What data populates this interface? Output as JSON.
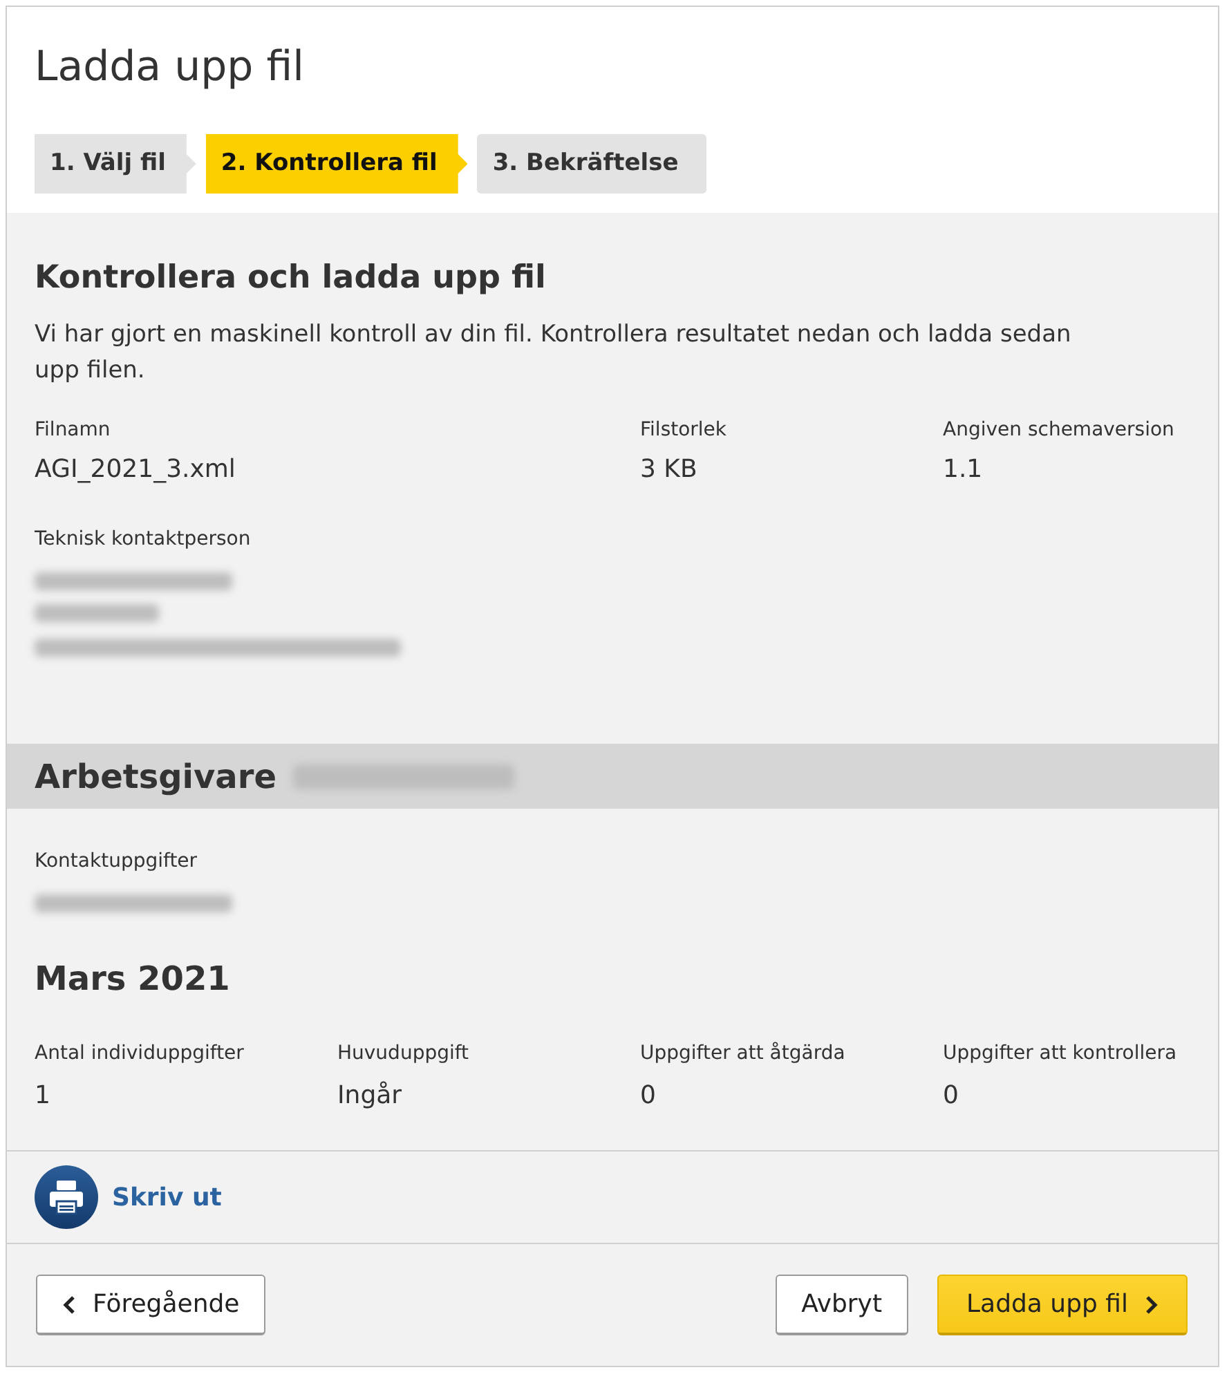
{
  "header": {
    "title": "Ladda upp fil"
  },
  "steps": [
    {
      "label": "1. Välj fil",
      "selected": false
    },
    {
      "label": "2. Kontrollera fil",
      "selected": true
    },
    {
      "label": "3. Bekräftelse",
      "selected": false
    }
  ],
  "check": {
    "heading": "Kontrollera och ladda upp fil",
    "text": "Vi har gjort en maskinell kontroll av din fil. Kontrollera resultatet nedan och ladda sedan upp filen.",
    "fields": [
      {
        "label": "Filnamn",
        "value": "AGI_2021_3.xml"
      },
      {
        "label": "Filstorlek",
        "value": "3 KB"
      },
      {
        "label": "Angiven schemaversion",
        "value": "1.1"
      }
    ],
    "contact_label": "Teknisk kontaktperson"
  },
  "employer": {
    "heading": "Arbetsgivare",
    "contact_label": "Kontaktuppgifter"
  },
  "period": {
    "heading": "Mars 2021",
    "fields": [
      {
        "label": "Antal individuppgifter",
        "value": "1"
      },
      {
        "label": "Huvuduppgift",
        "value": "Ingår"
      },
      {
        "label": "Uppgifter att åtgärda",
        "value": "0"
      },
      {
        "label": "Uppgifter att kontrollera",
        "value": "0"
      }
    ]
  },
  "print_link": {
    "label": "Skriv ut"
  },
  "footer": {
    "back": "Föregående",
    "cancel": "Avbryt",
    "submit": "Ladda upp fil"
  }
}
